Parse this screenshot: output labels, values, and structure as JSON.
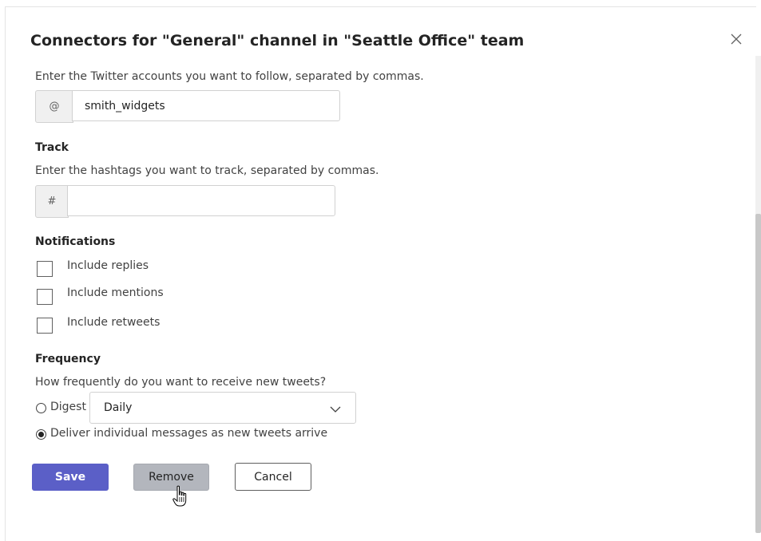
{
  "dialog": {
    "title": "Connectors for \"General\" channel in \"Seattle Office\" team"
  },
  "follow": {
    "instructions": "Enter the Twitter accounts you want to follow, separated by commas.",
    "prefix": "@",
    "value": "smith_widgets"
  },
  "track": {
    "heading": "Track",
    "instructions": "Enter the hashtags you want to track, separated by commas.",
    "prefix": "#",
    "value": ""
  },
  "notifications": {
    "heading": "Notifications",
    "options": [
      {
        "label": "Include replies",
        "checked": false
      },
      {
        "label": "Include mentions",
        "checked": false
      },
      {
        "label": "Include retweets",
        "checked": false
      }
    ]
  },
  "frequency": {
    "heading": "Frequency",
    "question": "How frequently do you want to receive new tweets?",
    "digest_label": "Digest",
    "digest_selected": false,
    "digest_value": "Daily",
    "individual_label": "Deliver individual messages as new tweets arrive",
    "individual_selected": true
  },
  "buttons": {
    "save": "Save",
    "remove": "Remove",
    "cancel": "Cancel"
  },
  "colors": {
    "primary": "#5b5fc7",
    "disabled": "#b3b6bd"
  },
  "icons": {
    "close": "close-icon",
    "chevron": "chevron-down-icon",
    "cursor": "hand-pointer-icon"
  }
}
